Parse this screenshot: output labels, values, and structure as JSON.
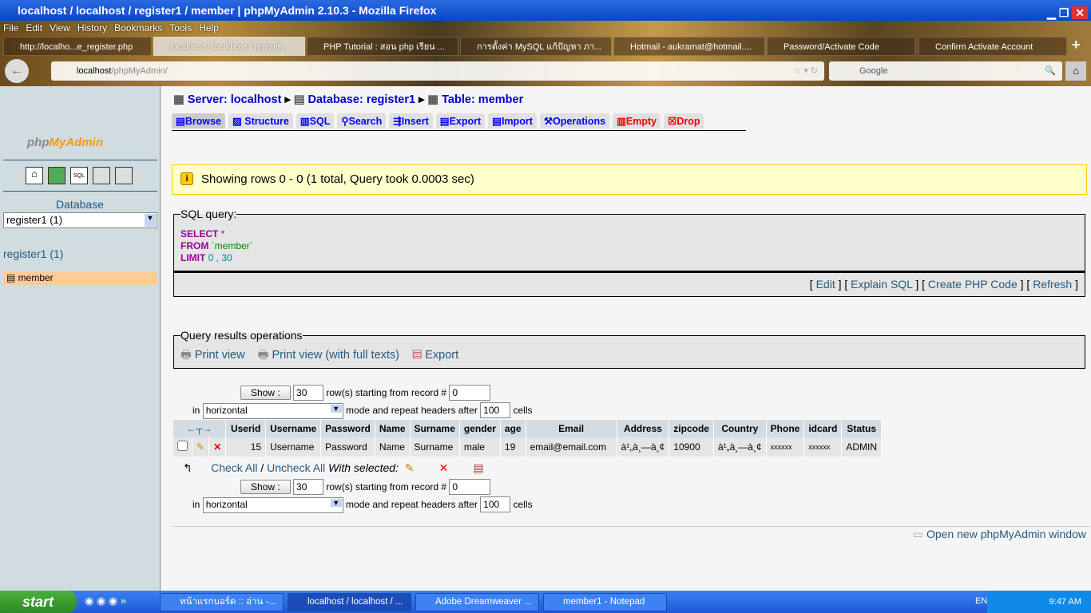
{
  "window": {
    "title": "localhost / localhost / register1 / member | phpMyAdmin 2.10.3 - Mozilla Firefox"
  },
  "menu": [
    "File",
    "Edit",
    "View",
    "History",
    "Bookmarks",
    "Tools",
    "Help"
  ],
  "tabs": [
    "http://localho...e_register.php",
    "localhost / localhost / registe...",
    "PHP Tutorial : สอน php เรียน ...",
    "การตั้งค่า MySQL แก้ปัญหา ภา...",
    "Hotmail - aukramat@hotmail....",
    "Password/Activate Code",
    "Confirm Activate Account"
  ],
  "url": {
    "host": "localhost",
    "path": "/phpMyAdmin/"
  },
  "search_placeholder": "Google",
  "sidebar": {
    "logo": "phpMyAdmin",
    "db_label": "Database",
    "db_select": "register1 (1)",
    "db_link": "register1 (1)",
    "table": "member"
  },
  "breadcrumb": {
    "server": "Server: localhost",
    "database": "Database: register1",
    "table": "Table: member"
  },
  "nav": [
    "Browse",
    "Structure",
    "SQL",
    "Search",
    "Insert",
    "Export",
    "Import",
    "Operations",
    "Empty",
    "Drop"
  ],
  "notice": "Showing rows 0 - 0 (1 total, Query took 0.0003 sec)",
  "sql": {
    "legend": "SQL query:",
    "l1k": "SELECT",
    "l1v": " *",
    "l2k": "FROM",
    "l2v": " `member`",
    "l3k": "LIMIT",
    "l3v": " 0 , 30",
    "links": [
      "Edit",
      "Explain SQL",
      "Create PHP Code",
      "Refresh"
    ]
  },
  "ops": {
    "legend": "Query results operations",
    "items": [
      "Print view",
      "Print view (with full texts)",
      "Export"
    ]
  },
  "nav_form": {
    "show": "Show :",
    "rows": "30",
    "rows_label": "row(s) starting from record #",
    "start": "0",
    "in": "in",
    "mode": "horizontal",
    "mode_label": "mode and repeat headers after",
    "repeat": "100",
    "cells": "cells"
  },
  "table": {
    "columns": [
      "Userid",
      "Username",
      "Password",
      "Name",
      "Surname",
      "gender",
      "age",
      "Email",
      "Address",
      "zipcode",
      "Country",
      "Phone",
      "idcard",
      "Status"
    ],
    "rows": [
      [
        "15",
        "Username",
        "Password",
        "Name",
        "Surname",
        "male",
        "19",
        "email@email.com",
        "à¹„à¸—à¸¢",
        "10900",
        "à¹„à¸—à¸¢",
        "xxxxxx",
        "xxxxxx",
        "ADMIN"
      ]
    ]
  },
  "check_all": "Check All",
  "uncheck_all": "Uncheck All",
  "with_selected": "With selected:",
  "open_new": "Open new phpMyAdmin window",
  "taskbar": {
    "start": "start",
    "items": [
      "หน้าแรกบอร์ด :: อ่าน -...",
      "localhost / localhost / ...",
      "Adobe Dreamweaver ...",
      "member1 - Notepad"
    ],
    "lang": "EN",
    "time": "9:47 AM"
  }
}
